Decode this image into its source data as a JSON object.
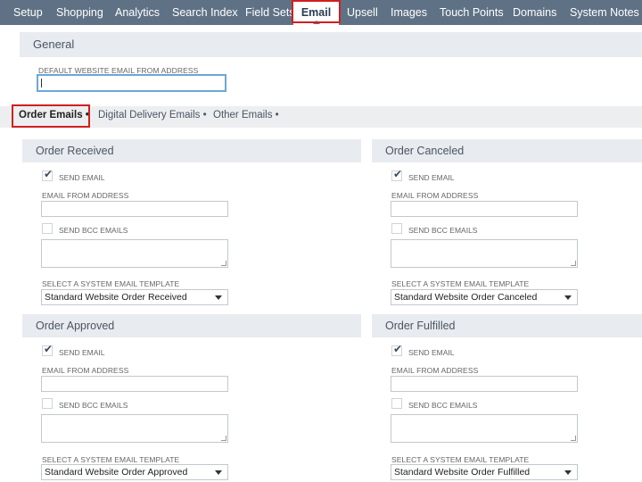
{
  "nav": {
    "tabs": [
      "Setup",
      "Shopping",
      "Analytics",
      "Search Index",
      "Field Sets",
      "Email",
      "Upsell",
      "Images",
      "Touch Points",
      "Domains",
      "System Notes"
    ],
    "active": "Email"
  },
  "general": {
    "title": "General",
    "default_from_label": "DEFAULT WEBSITE EMAIL FROM ADDRESS",
    "default_from_value": ""
  },
  "subtabs": [
    "Order Emails",
    "Digital Delivery Emails",
    "Other Emails"
  ],
  "panels": [
    {
      "title": "Order Received",
      "send_email_label": "SEND EMAIL",
      "send_email_checked": true,
      "from_label": "EMAIL FROM ADDRESS",
      "from_value": "",
      "bcc_label": "SEND BCC EMAILS",
      "bcc_checked": false,
      "template_label": "SELECT A SYSTEM EMAIL TEMPLATE",
      "template_value": "Standard Website Order Received"
    },
    {
      "title": "Order Canceled",
      "send_email_label": "SEND EMAIL",
      "send_email_checked": true,
      "from_label": "EMAIL FROM ADDRESS",
      "from_value": "",
      "bcc_label": "SEND BCC EMAILS",
      "bcc_checked": false,
      "template_label": "SELECT A SYSTEM EMAIL TEMPLATE",
      "template_value": "Standard Website Order Canceled"
    },
    {
      "title": "Order Approved",
      "send_email_label": "SEND EMAIL",
      "send_email_checked": true,
      "from_label": "EMAIL FROM ADDRESS",
      "from_value": "",
      "bcc_label": "SEND BCC EMAILS",
      "bcc_checked": false,
      "template_label": "SELECT A SYSTEM EMAIL TEMPLATE",
      "template_value": "Standard Website Order Approved"
    },
    {
      "title": "Order Fulfilled",
      "send_email_label": "SEND EMAIL",
      "send_email_checked": true,
      "from_label": "EMAIL FROM ADDRESS",
      "from_value": "",
      "bcc_label": "SEND BCC EMAILS",
      "bcc_checked": false,
      "template_label": "SELECT A SYSTEM EMAIL TEMPLATE",
      "template_value": "Standard Website Order Fulfilled"
    }
  ],
  "colors": {
    "nav_bg": "#5f7285",
    "highlight": "#d11f1f",
    "focus": "#6aa7d8"
  }
}
